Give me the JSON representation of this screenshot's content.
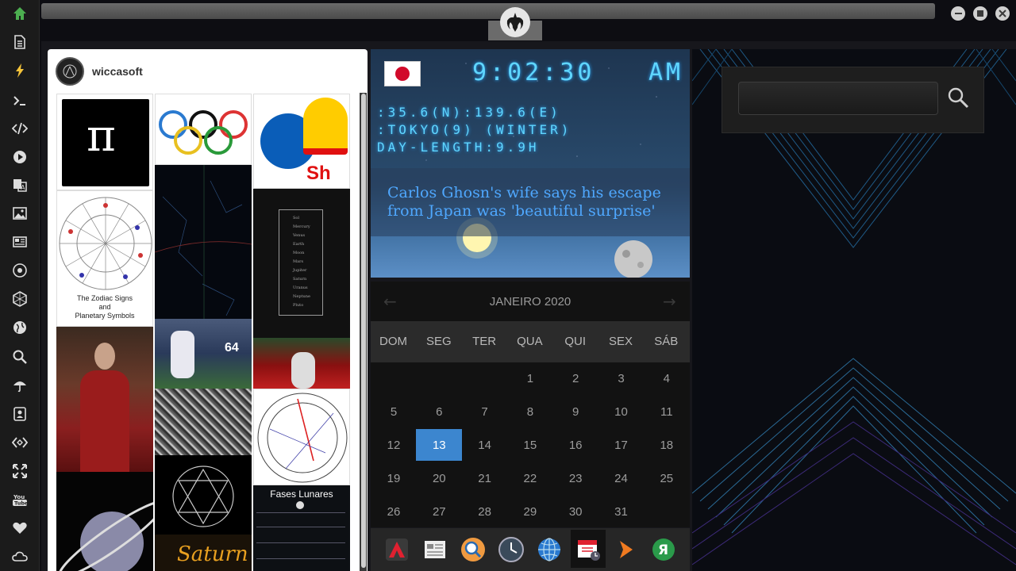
{
  "sidebar": {
    "items": [
      {
        "name": "home-icon"
      },
      {
        "name": "document-icon"
      },
      {
        "name": "lightning-icon"
      },
      {
        "name": "terminal-icon"
      },
      {
        "name": "code-icon"
      },
      {
        "name": "play-icon"
      },
      {
        "name": "translate-icon"
      },
      {
        "name": "image-icon"
      },
      {
        "name": "news-icon"
      },
      {
        "name": "rebel-icon"
      },
      {
        "name": "hexagon-icon"
      },
      {
        "name": "globe-icon"
      },
      {
        "name": "search-icon"
      },
      {
        "name": "umbrella-icon"
      },
      {
        "name": "contact-icon"
      },
      {
        "name": "tags-icon"
      },
      {
        "name": "expand-icon"
      },
      {
        "name": "youtube-icon"
      },
      {
        "name": "heart-icon"
      },
      {
        "name": "cloud-icon"
      }
    ],
    "youtube_label": "You Tube"
  },
  "pin": {
    "username": "wiccasoft",
    "zodiac_caption_1": "The Zodiac Signs",
    "zodiac_caption_2": "and",
    "zodiac_caption_3": "Planetary Symbols",
    "fases_title": "Fases Lunares",
    "shell_label": "Sh",
    "saturn_label": "Saturn",
    "pi_label": "π",
    "planets": [
      "Sol",
      "Mercury",
      "Venus",
      "Earth",
      "Moon",
      "Mars",
      "Jupiter",
      "Saturn",
      "Uranus",
      "Neptune",
      "Pluto"
    ],
    "jersey_number": "64"
  },
  "clock": {
    "time": "9:02:30",
    "ampm": "AM",
    "coords": ":35.6(N):139.6(E)",
    "location": ":TOKYO(9) (WINTER)",
    "daylength": "DAY-LENGTH:9.9H",
    "news": "Carlos Ghosn's wife says his escape from Japan was 'beautiful surprise'"
  },
  "calendar": {
    "month_label": "JANEIRO 2020",
    "day_names": [
      "DOM",
      "SEG",
      "TER",
      "QUA",
      "QUI",
      "SEX",
      "SÁB"
    ],
    "weeks": [
      [
        "",
        "",
        "",
        "1",
        "2",
        "3",
        "4"
      ],
      [
        "5",
        "6",
        "7",
        "8",
        "9",
        "10",
        "11"
      ],
      [
        "12",
        "13",
        "14",
        "15",
        "16",
        "17",
        "18"
      ],
      [
        "19",
        "20",
        "21",
        "22",
        "23",
        "24",
        "25"
      ],
      [
        "26",
        "27",
        "28",
        "29",
        "30",
        "31",
        ""
      ]
    ],
    "today": "13"
  },
  "dock": {
    "items": [
      "red-a-icon",
      "newspaper-icon",
      "magnifier-icon",
      "clock-icon",
      "globe-icon",
      "calendar-icon",
      "arrow-icon",
      "ya-icon"
    ],
    "ya_letter": "Я"
  },
  "search": {
    "placeholder": "",
    "value": ""
  },
  "colors": {
    "accent": "#3c86cf",
    "lcd": "#5fd6ff",
    "sidebar_active": "#4caf50"
  }
}
